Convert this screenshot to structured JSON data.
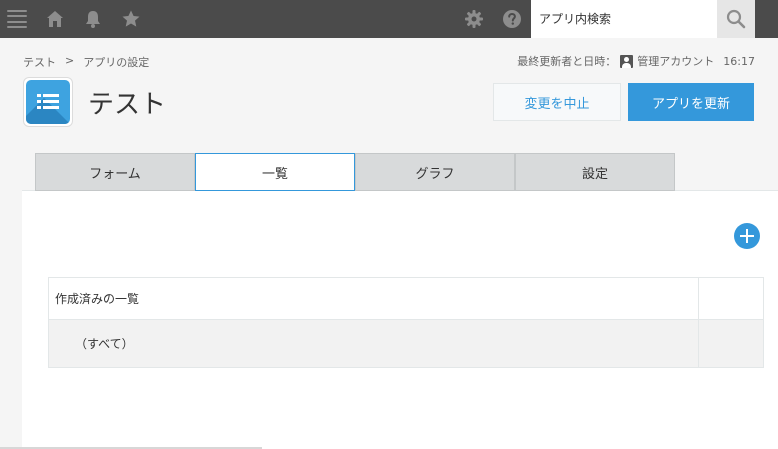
{
  "topbar": {
    "icons": [
      "menu-icon",
      "home-icon",
      "bell-icon",
      "star-icon",
      "gear-icon",
      "help-icon",
      "search-icon"
    ],
    "search_placeholder": "アプリ内検索"
  },
  "breadcrumb": {
    "root": "テスト",
    "separator": ">",
    "current": "アプリの設定"
  },
  "update_info": {
    "label": "最終更新者と日時：",
    "user": "管理アカウント",
    "time": "16:17"
  },
  "app": {
    "title": "テスト",
    "icon": "list-app-icon",
    "accent_color": "#3ea3e0"
  },
  "actions": {
    "cancel_label": "変更を中止",
    "update_label": "アプリを更新",
    "primary_color": "#3498db"
  },
  "tabs": [
    {
      "label": "フォーム",
      "active": false
    },
    {
      "label": "一覧",
      "active": true
    },
    {
      "label": "グラフ",
      "active": false
    },
    {
      "label": "設定",
      "active": false
    }
  ],
  "views": {
    "header": "作成済みの一覧",
    "items": [
      {
        "label": "（すべて）"
      }
    ]
  }
}
